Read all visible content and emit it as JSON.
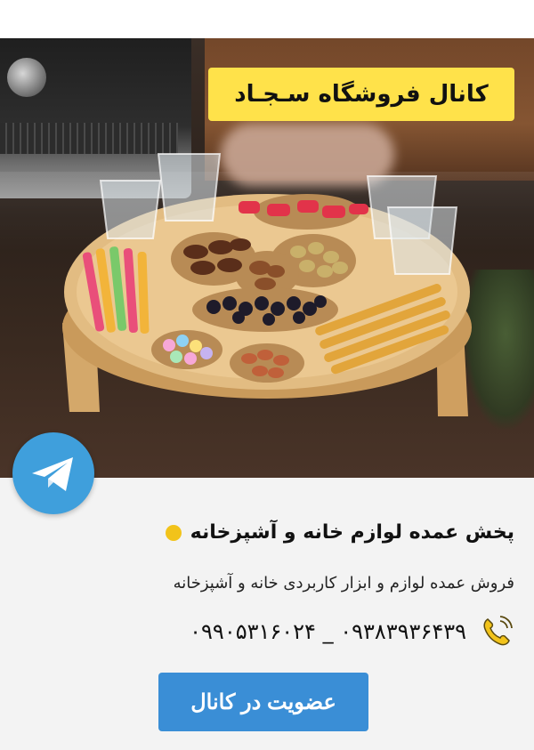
{
  "banner": {
    "channel_title": "کانال فروشگاه سـجـاد"
  },
  "info": {
    "headline": "پخش عمده لوازم خانه و آشپزخانه",
    "subtitle": "فروش عمده لوازم و ابزار کاربردی خانه و آشپزخانه",
    "phones": "۰۹۳۸۳۹۳۶۴۳۹ _ ۰۹۹۰۵۳۱۶۰۲۴"
  },
  "actions": {
    "join_label": "عضویت در کانال"
  },
  "icons": {
    "telegram": "telegram-icon",
    "phone": "phone-icon",
    "bullet": "bullet-dot"
  },
  "colors": {
    "badge": "#ffe24a",
    "button": "#3a8ed6",
    "telegram": "#3f9fdc",
    "bullet": "#f2c31a"
  }
}
